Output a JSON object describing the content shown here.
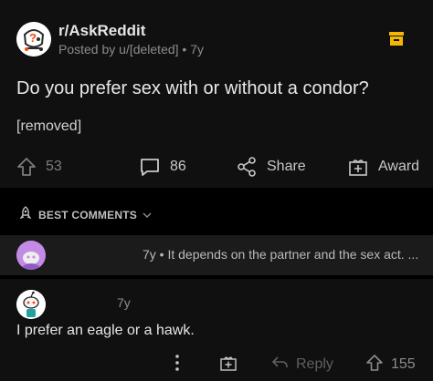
{
  "post": {
    "subreddit": "r/AskReddit",
    "meta": "Posted by u/[deleted] • 7y",
    "title": "Do you prefer sex with or without a condor?",
    "body": "[removed]",
    "votes": "53",
    "comments": "86",
    "share_label": "Share",
    "award_label": "Award"
  },
  "sort": {
    "label": "BEST COMMENTS"
  },
  "collapsed_comment": {
    "line": "7y • It depends on the partner and the sex act. ..."
  },
  "comment": {
    "time": "7y",
    "text": "I prefer an eagle or a hawk.",
    "reply_label": "Reply",
    "votes": "155"
  },
  "colors": {
    "background": "#101010",
    "collapsed_background": "#1b1b1b",
    "save_icon": "#f2b705",
    "avatar_purple": "#c38ae6"
  }
}
